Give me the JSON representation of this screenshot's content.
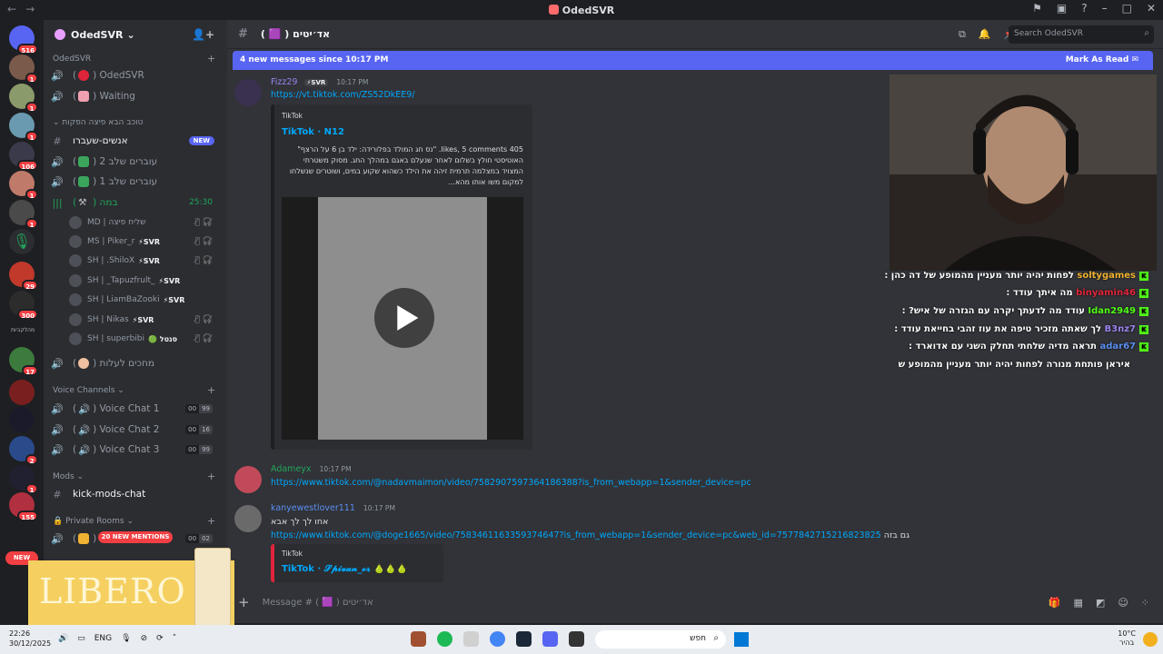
{
  "window": {
    "title": "OdedSVR",
    "back": "←",
    "forward": "→"
  },
  "rail": {
    "badges": [
      "516",
      "1",
      "1",
      "1",
      "106",
      "1",
      "1",
      "29",
      "300",
      "17",
      "2",
      "1",
      "155"
    ],
    "label_text": "מהלקביות",
    "new_label": "NEW"
  },
  "guild": {
    "name": "OdedSVR",
    "chevron": "⌄"
  },
  "sidebar": {
    "categories": [
      {
        "label": "OdedSVR"
      },
      {
        "label": "טוכב הבא פיצה הפקות ⌄"
      },
      {
        "label": "Voice Channels ⌄"
      },
      {
        "label": "Mods ⌄"
      },
      {
        "label": "🔒 Private Rooms ⌄"
      }
    ],
    "channels": [
      {
        "label": "OdedSVR"
      },
      {
        "label": "Waiting"
      },
      {
        "label": "אנשים-שעברו",
        "tag": "NEW"
      },
      {
        "label": "עוברים שלב 2"
      },
      {
        "label": "עוברים שלב 1"
      },
      {
        "label": "במה",
        "timer": "25:30"
      },
      {
        "label": "מחכים לעלות"
      },
      {
        "label": "Voice Chat 1",
        "c1": "00",
        "c2": "99"
      },
      {
        "label": "Voice Chat 2",
        "c1": "00",
        "c2": "16"
      },
      {
        "label": "Voice Chat 3",
        "c1": "00",
        "c2": "99"
      },
      {
        "label": "kick-mods-chat"
      },
      {
        "c1": "00",
        "c2": "02"
      }
    ],
    "members": [
      {
        "name": "MD | שליח פיצה"
      },
      {
        "name": "MS | Piker_r",
        "tag": "⚡SVR"
      },
      {
        "name": "SH | .ShiloX",
        "tag": "⚡SVR"
      },
      {
        "name": "SH | _Tapuzfrult_",
        "tag": "⚡SVR"
      },
      {
        "name": "SH | LiamBaZooki",
        "tag": "⚡SVR"
      },
      {
        "name": "SH | Nikas",
        "tag": "⚡SVR"
      },
      {
        "name": "SH | superbibi",
        "tag": "🟢 סנטל"
      }
    ],
    "mentions": "20 NEW MENTIONS"
  },
  "header": {
    "channel": "( 🟪 ) אד׳יטים",
    "search_placeholder": "Search OdedSVR"
  },
  "banner": {
    "text": "4 new messages since 10:17 PM",
    "action": "Mark As Read"
  },
  "messages": [
    {
      "author": "Fizz29",
      "tag": "⚡SVR",
      "time": "10:17 PM",
      "link": "https://vt.tiktok.com/ZS52DkEE9/",
      "embed": {
        "provider": "TikTok",
        "title": "TikTok · N12",
        "desc": [
          "405 likes, 5 comments. \"נס חג המולד בפלורידה: ילד בן 6 על הרצף\"",
          "האוטיסטי חולץ בשלום לאחר שנעלם באגם במהלך החג. מסוק משטרתי",
          "המצויד במצלמה תרמית זיהה את הילד כשהוא שקוע במים, ושוטרים שנשלחו",
          "למקום משו אותו מהא..."
        ]
      }
    },
    {
      "author": "Adameyx",
      "time": "10:17 PM",
      "link": "https://www.tiktok.com/@nadavmaimon/video/7582907597364186388?is_from_webapp=1&sender_device=pc"
    },
    {
      "author": "kanyewestlover111",
      "time": "10:17 PM",
      "text": "אחו לך לך אבא",
      "link": "https://www.tiktok.com/@doge1665/video/7583461163359374647?is_from_webapp=1&sender_device=pc&web_id=7577842715216823825",
      "suffix": "גם בזה",
      "embed": {
        "provider": "TikTok",
        "title": "TikTok · 𝓢𝓹𝓲𝓿𝓪𝓷_𝓸𝓻 🍐🍐🍐"
      }
    }
  ],
  "composer": {
    "placeholder": "Message # ( 🟪 ) אד׳יטים"
  },
  "stream_chat": [
    {
      "user": "soltygames",
      "msg": "לפחות יהיה יותר מעניין מהמופע של דה כהן :"
    },
    {
      "user": "binyamin46",
      "msg": "מה איתך עודד :"
    },
    {
      "user": "Idan2949",
      "msg": "עודד מה לדעתך יקרה עם הגזרה של איש? :"
    },
    {
      "user": "B3nz7",
      "msg": "לך שאתה מזכיר טיפה את עוז זהבי בחייאת עודד :"
    },
    {
      "user": "adar67",
      "msg": "תראה מדיה שלחתי תחלק השני עם אדוארד :"
    },
    {
      "user": "",
      "msg": "איראן פותחת מנורה לפחות יהיה יותר מעניין מהמופע ש"
    }
  ],
  "ad": {
    "brand": "LIBERO"
  },
  "taskbar": {
    "time": "22:26",
    "date": "30/12/2025",
    "lang": "ENG",
    "search_text": "חפש",
    "temp": "10°C",
    "weather": "בהיר"
  },
  "colors": {
    "accent": "#5865f2",
    "link": "#00a8fc",
    "danger": "#f23f43",
    "online": "#23a55a",
    "kick": "#53fc18"
  }
}
